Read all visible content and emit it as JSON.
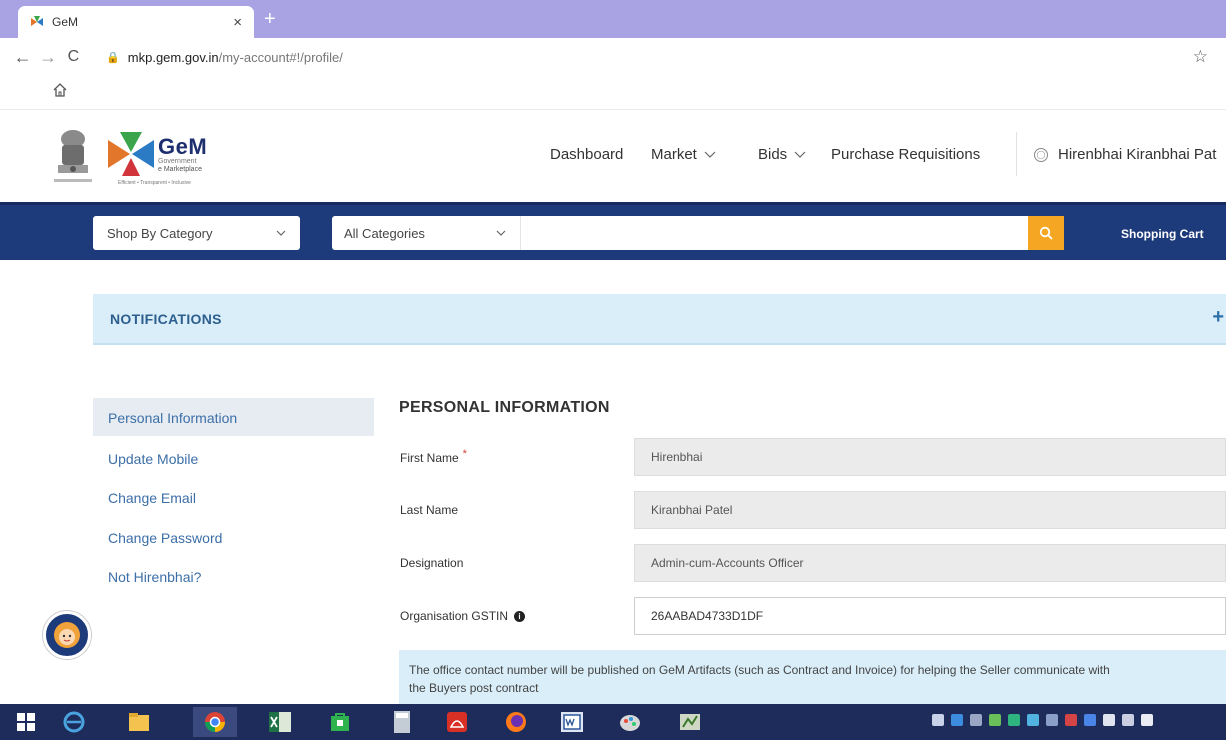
{
  "browser": {
    "tab_title": "GeM",
    "tab_close": "×",
    "new_tab": "+",
    "url_host": "mkp.gem.gov.in",
    "url_path": "/my-account#!/profile/"
  },
  "header": {
    "logo_word": "GeM",
    "logo_sub1": "Government",
    "logo_sub2": "e Marketplace",
    "logo_tagline": "Efficient • Transparent • Inclusive",
    "nav": {
      "dashboard": "Dashboard",
      "market": "Market",
      "bids": "Bids",
      "purchase_requisitions": "Purchase Requisitions"
    },
    "user_name": "Hirenbhai Kiranbhai Pat"
  },
  "search": {
    "shop_by_category": "Shop By Category",
    "all_categories": "All Categories",
    "placeholder": "",
    "shopping_cart": "Shopping Cart"
  },
  "notifications": {
    "title": "NOTIFICATIONS",
    "expand": "+"
  },
  "sidebar": {
    "items": [
      {
        "label": "Personal Information",
        "active": true
      },
      {
        "label": "Update Mobile",
        "active": false
      },
      {
        "label": "Change Email",
        "active": false
      },
      {
        "label": "Change Password",
        "active": false
      },
      {
        "label": "Not Hirenbhai?",
        "active": false
      }
    ]
  },
  "form": {
    "title": "PERSONAL INFORMATION",
    "fields": [
      {
        "label": "First Name",
        "required": "*",
        "value": "Hirenbhai"
      },
      {
        "label": "Last Name",
        "value": "Kiranbhai Patel"
      },
      {
        "label": "Designation",
        "value": "Admin-cum-Accounts Officer"
      },
      {
        "label": "Organisation GSTIN",
        "info": "i",
        "value": "26AABAD4733D1DF"
      }
    ],
    "note_line1": "The office contact number will be published on GeM Artifacts (such as Contract and Invoice) for helping the Seller communicate with",
    "note_line2": "the Buyers post contract"
  },
  "colors": {
    "nav_blue": "#1d3a7a",
    "search_orange": "#f5a623",
    "link_blue": "#3c6fa8",
    "notif_bg": "#d9eef8",
    "tabbar": "#a9a2e3"
  }
}
